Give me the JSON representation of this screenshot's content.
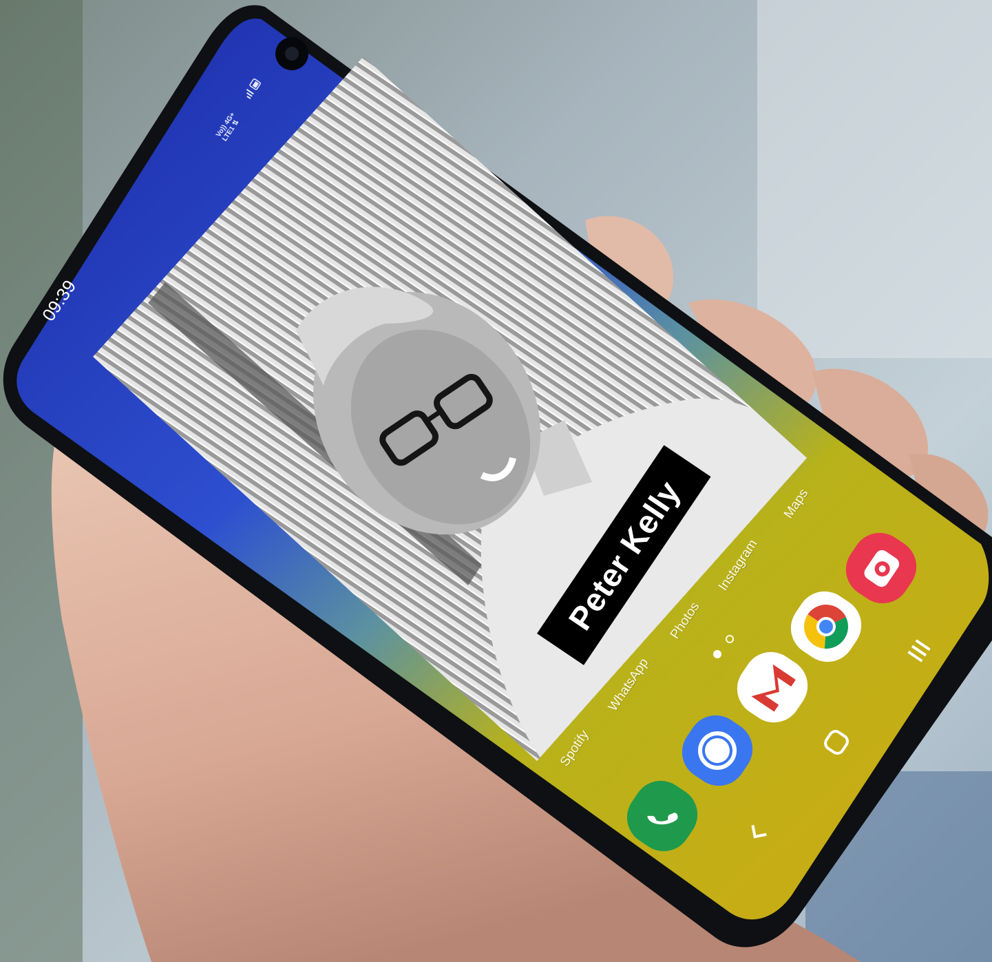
{
  "status_bar": {
    "time": "09:39",
    "network_line1": "Vo)) 4G+",
    "network_line2": "LTE1 ⇅"
  },
  "home_apps": [
    {
      "label": "Spotify"
    },
    {
      "label": "WhatsApp"
    },
    {
      "label": "Photos"
    },
    {
      "label": "Instagram"
    },
    {
      "label": "Maps"
    }
  ],
  "dock": [
    {
      "name": "phone-app-icon",
      "icon": "phone-icon",
      "color": "#1f9a4c"
    },
    {
      "name": "signal-app-icon",
      "icon": "message-bubble-icon",
      "color": "#3a76f0"
    },
    {
      "name": "gmail-app-icon",
      "icon": "gmail-icon",
      "color": "#ffffff"
    },
    {
      "name": "chrome-app-icon",
      "icon": "chrome-icon",
      "color": "#ffffff"
    },
    {
      "name": "camera-app-icon",
      "icon": "camera-icon",
      "color": "#e8374f"
    }
  ],
  "nav": {
    "recents": "recents-icon",
    "home": "home-icon",
    "back": "back-icon"
  },
  "name_banner": {
    "text": "Peter Kelly"
  },
  "colors": {
    "wallpaper_blue": "#1d2fa8",
    "wallpaper_yellow": "#c9a813",
    "phone_frame": "#111418",
    "banner": "#000000"
  }
}
